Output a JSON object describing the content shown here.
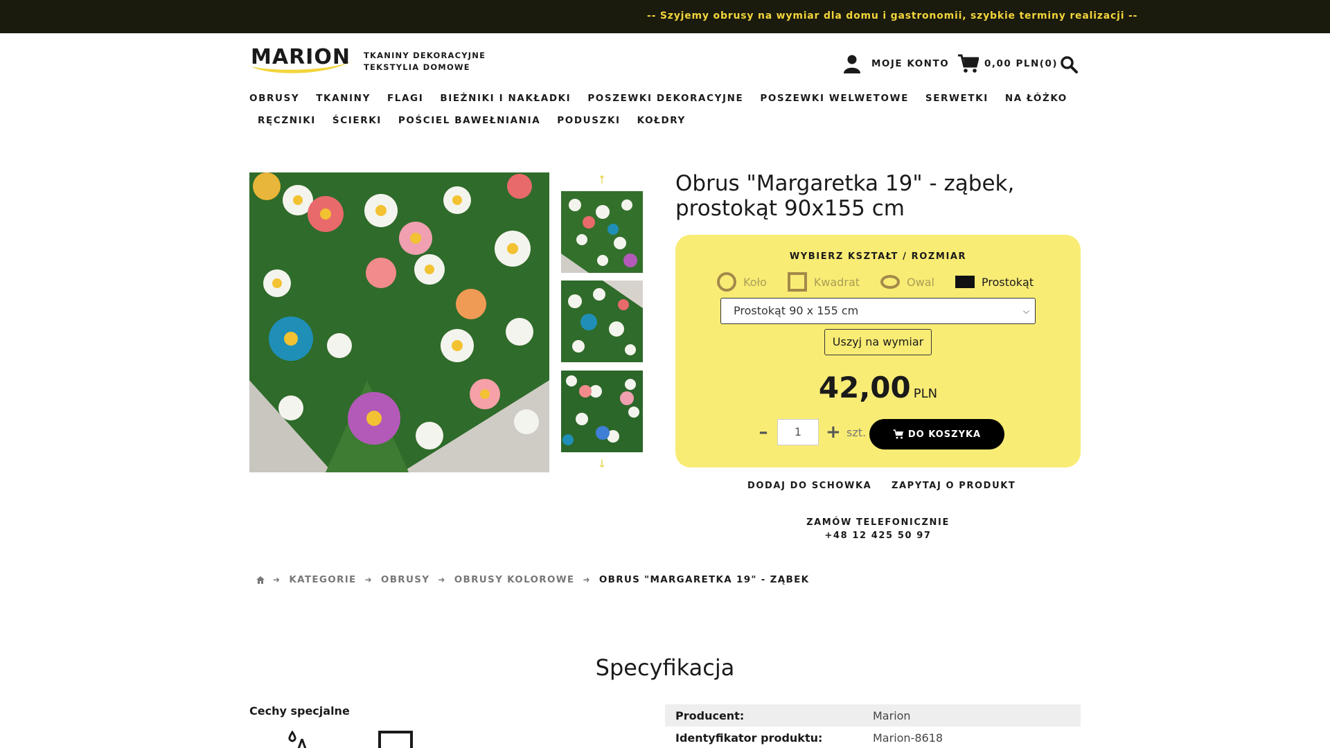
{
  "topbar": {
    "announcement": "--  Szyjemy obrusy na wymiar dla domu i gastronomii, szybkie terminy realizacji --"
  },
  "brand": {
    "logo_text": "MARION",
    "tagline_line1": "TKANINY DEKORACYJNE",
    "tagline_line2": "TEKSTYLIA DOMOWE"
  },
  "header": {
    "account_label": "MOJE KONTO",
    "cart_label": "0,00 PLN(0)"
  },
  "nav": {
    "row1": [
      "OBRUSY",
      "TKANINY",
      "FLAGI",
      "BIEŻNIKI I NAKŁADKI",
      "POSZEWKI DEKORACYJNE",
      "POSZEWKI WELWETOWE",
      "SERWETKI",
      "NA ŁÓŻKO"
    ],
    "row2": [
      "RĘCZNIKI",
      "ŚCIERKI",
      "POŚCIEL BAWEŁNIANIA",
      "PODUSZKI",
      "KOŁDRY"
    ]
  },
  "product": {
    "title": "Obrus \"Margaretka 19\" - ząbek, prostokąt 90x155 cm",
    "choose_label": "WYBIERZ KSZTAŁT / ROZMIAR",
    "shapes": [
      "Koło",
      "Kwadrat",
      "Owal",
      "Prostokąt"
    ],
    "selected_shape": "Prostokąt",
    "size_value": "Prostokąt 90 x 155 cm",
    "custom_button": "Uszyj na wymiar",
    "price": "42,00",
    "currency": "PLN",
    "quantity": "1",
    "unit": "szt.",
    "add_to_cart": "DO KOSZYKA",
    "add_to_wishlist": "DODAJ DO SCHOWKA",
    "ask_about": "ZAPYTAJ O PRODUKT",
    "phone_label": "ZAMÓW TELEFONICZNIE",
    "phone_number": "+48 12 425 50 97"
  },
  "breadcrumb": [
    "KATEGORIE",
    "OBRUSY",
    "OBRUSY KOLOROWE",
    "OBRUS \"MARGARETKA 19\" - ZĄBEK"
  ],
  "spec": {
    "title": "Specyfikacja",
    "features_label": "Cechy specjalne",
    "rows": [
      {
        "key": "Producent:",
        "value": "Marion"
      },
      {
        "key": "Identyfikator produktu:",
        "value": "Marion-8618"
      }
    ]
  },
  "colors": {
    "accent_yellow": "#f9ec75",
    "topbar_bg": "#1a1a0d",
    "topbar_text": "#f2d53c"
  },
  "icons": [
    "user-icon",
    "cart-icon",
    "search-icon",
    "home-icon",
    "arrow-up-icon",
    "arrow-down-icon"
  ]
}
